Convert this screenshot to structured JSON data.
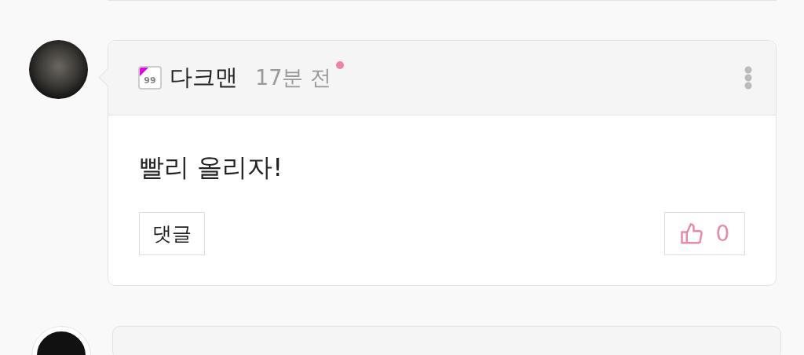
{
  "comments": [
    {
      "level_badge": "99",
      "author": "다크맨",
      "time": "17분 전",
      "new": true,
      "body": "빨리 올리자!",
      "reply_button": "댓글",
      "likes": "0",
      "liked": false
    }
  ]
}
